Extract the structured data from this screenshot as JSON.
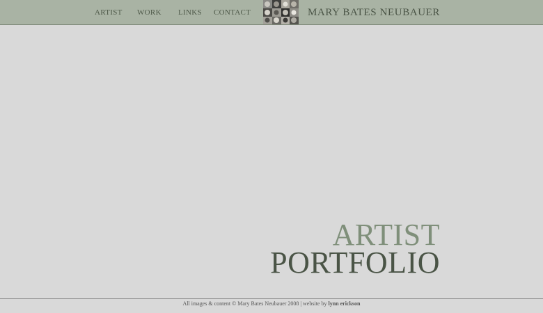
{
  "nav": {
    "items": [
      {
        "label": "ARTIST"
      },
      {
        "label": "WORK"
      },
      {
        "label": "LINKS"
      },
      {
        "label": "CONTACT"
      }
    ]
  },
  "header": {
    "site_title": "MARY BATES NEUBAUER",
    "thumbnail_icon": "artwork-collage-thumbnail"
  },
  "hero": {
    "line1": "ARTIST",
    "line2": "PORTFOLIO"
  },
  "footer": {
    "copyright": "All images & content © Mary Bates Neubauer 2008 | website by ",
    "credit": "lynn erickson"
  },
  "colors": {
    "page_background": "#d9d9d9",
    "header_background": "#a9b3a4",
    "nav_text": "#4d5848",
    "hero_light": "#7f8f7a",
    "hero_dark": "#4a5446"
  }
}
